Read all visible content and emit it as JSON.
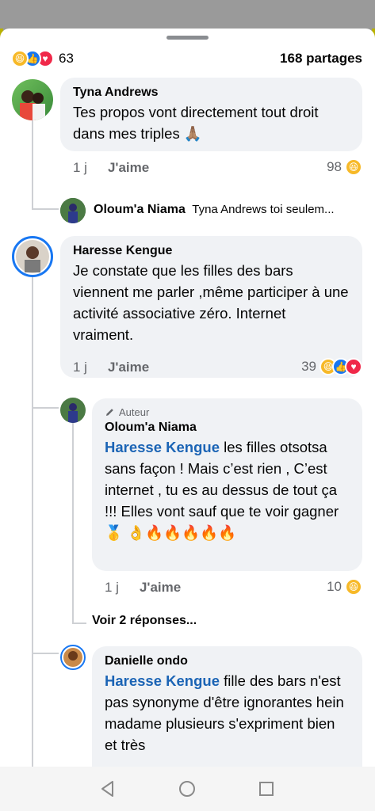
{
  "header": {
    "reaction_count": "63",
    "shares": "168 partages",
    "reactions": [
      "haha-icon",
      "like-icon",
      "love-icon"
    ]
  },
  "comments": [
    {
      "name": "Tyna Andrews",
      "text": "Tes propos vont directement tout droit dans mes triples 🙏🏽",
      "time": "1 j",
      "like": "J'aime",
      "reactions": "98"
    },
    {
      "collapsed_name": "Oloum'a Niama",
      "collapsed_text": "Tyna Andrews  toi seulem..."
    },
    {
      "name": "Haresse Kengue",
      "text": "Je constate que les filles des bars viennent me parler ,même participer à une activité associative zéro. Internet vraiment.",
      "time": "1 j",
      "like": "J'aime",
      "reactions": "39"
    },
    {
      "badge": "Auteur",
      "name": "Oloum'a Niama",
      "mention": "Haresse Kengue",
      "text": " les filles otsotsa sans façon ! Mais c’est rien ,  C’est internet , tu es au dessus de tout ça !!! Elles vont sauf que te voir gagner 🥇 👌🔥🔥🔥🔥🔥",
      "time": "1 j",
      "like": "J'aime",
      "reactions": "10"
    },
    {
      "more_replies": "Voir 2 réponses..."
    },
    {
      "name": "Danielle ondo",
      "mention": "Haresse Kengue",
      "text": " fille des bars n'est pas synonyme d'être ignorantes hein madame plusieurs s'expriment bien et très"
    }
  ],
  "colors": {
    "accent": "#1b64b5",
    "bubble": "#f0f2f5",
    "muted": "#65676b"
  }
}
